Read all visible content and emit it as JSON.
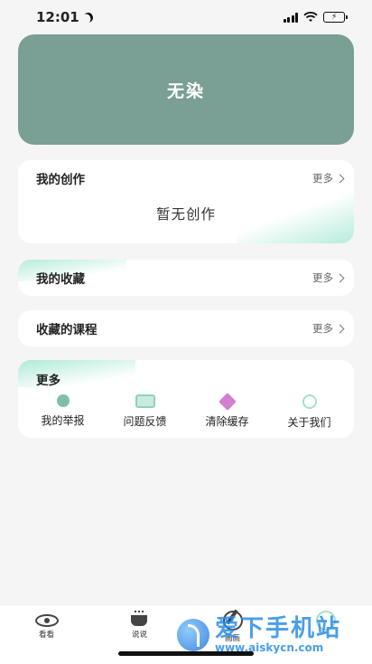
{
  "status_bar": {
    "time": "12:01",
    "icons": [
      "moon-icon",
      "signal-icon",
      "wifi-icon",
      "battery-charging-icon"
    ]
  },
  "banner": {
    "title": "无染",
    "color": "#7a9f94"
  },
  "creation": {
    "title": "我的创作",
    "more": "更多",
    "empty": "暂无创作"
  },
  "collection": {
    "title": "我的收藏",
    "more": "更多"
  },
  "courses": {
    "title": "收藏的课程",
    "more": "更多"
  },
  "more_section": {
    "title": "更多",
    "items": [
      {
        "label": "我的举报",
        "icon": "report-icon"
      },
      {
        "label": "问题反馈",
        "icon": "feedback-icon"
      },
      {
        "label": "清除缓存",
        "icon": "clear-cache-icon"
      },
      {
        "label": "关于我们",
        "icon": "about-us-icon"
      }
    ]
  },
  "tabbar": {
    "tabs": [
      {
        "label": "看看",
        "icon": "eye-icon"
      },
      {
        "label": "说说",
        "icon": "cup-icon"
      },
      {
        "label": "画画",
        "icon": "draw-icon"
      },
      {
        "label": "",
        "icon": "profile-icon"
      }
    ]
  },
  "watermark": {
    "title": "爱下手机站",
    "url": "www.aiskycn.com"
  }
}
